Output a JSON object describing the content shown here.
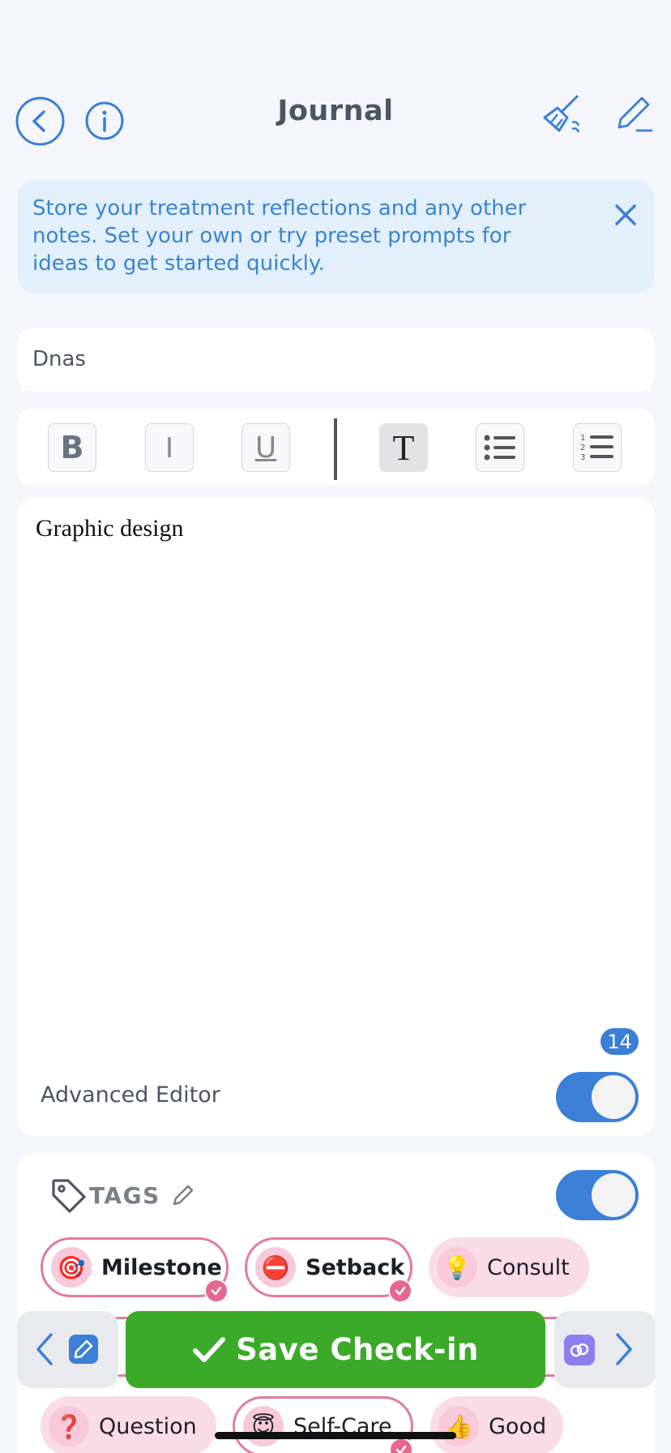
{
  "header": {
    "title": "Journal",
    "back_icon": "chevron-left-icon",
    "info_icon": "info-icon",
    "clear_icon": "broom-icon",
    "edit_icon": "pencil-icon"
  },
  "banner": {
    "text": "Store your treatment reflections and any other notes. Set your own or try preset prompts for ideas to get started quickly."
  },
  "entry": {
    "title_value": "Dnas",
    "body": "Graphic design",
    "char_count": "14"
  },
  "toolbar": {
    "bold": "B",
    "italic": "I",
    "underline": "U",
    "text": "T"
  },
  "advanced_editor": {
    "label": "Advanced Editor",
    "enabled": true
  },
  "tags": {
    "title": "TAGS",
    "enabled": true,
    "items": [
      {
        "label": "Milestone",
        "emoji": "🎯",
        "selected": true
      },
      {
        "label": "Setback",
        "emoji": "⛔",
        "selected": true
      },
      {
        "label": "Consult",
        "emoji": "💡",
        "selected": false
      },
      {
        "label": "Question",
        "emoji": "❓",
        "selected": false
      },
      {
        "label": "Self-Care",
        "emoji": "😇",
        "selected": true
      },
      {
        "label": "Good",
        "emoji": "👍",
        "selected": false
      }
    ]
  },
  "footer": {
    "save_label": "Save Check-in"
  },
  "colors": {
    "accent": "#3b7fd6",
    "save": "#3aaa28",
    "tag_pink": "#e07ba0"
  }
}
